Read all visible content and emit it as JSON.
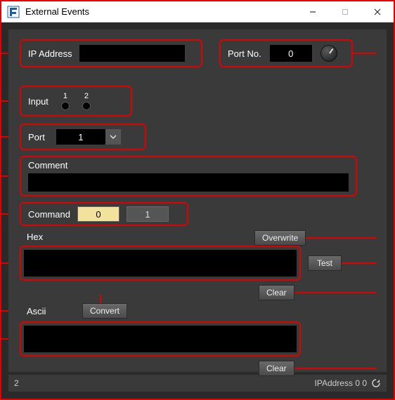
{
  "titlebar": {
    "title": "External Events"
  },
  "ip": {
    "label": "IP Address",
    "value": ""
  },
  "portno": {
    "label": "Port No.",
    "value": "0"
  },
  "input": {
    "label": "Input",
    "led1": "1",
    "led2": "2"
  },
  "port": {
    "label": "Port",
    "value": "1"
  },
  "comment": {
    "label": "Comment",
    "value": ""
  },
  "command": {
    "label": "Command",
    "opt0": "0",
    "opt1": "1"
  },
  "hex": {
    "label": "Hex",
    "value": ""
  },
  "ascii": {
    "label": "Ascii",
    "value": ""
  },
  "buttons": {
    "overwrite": "Overwrite",
    "test": "Test",
    "clear": "Clear",
    "convert": "Convert"
  },
  "status": {
    "left": "2",
    "right": "IPAddress 0 0"
  }
}
